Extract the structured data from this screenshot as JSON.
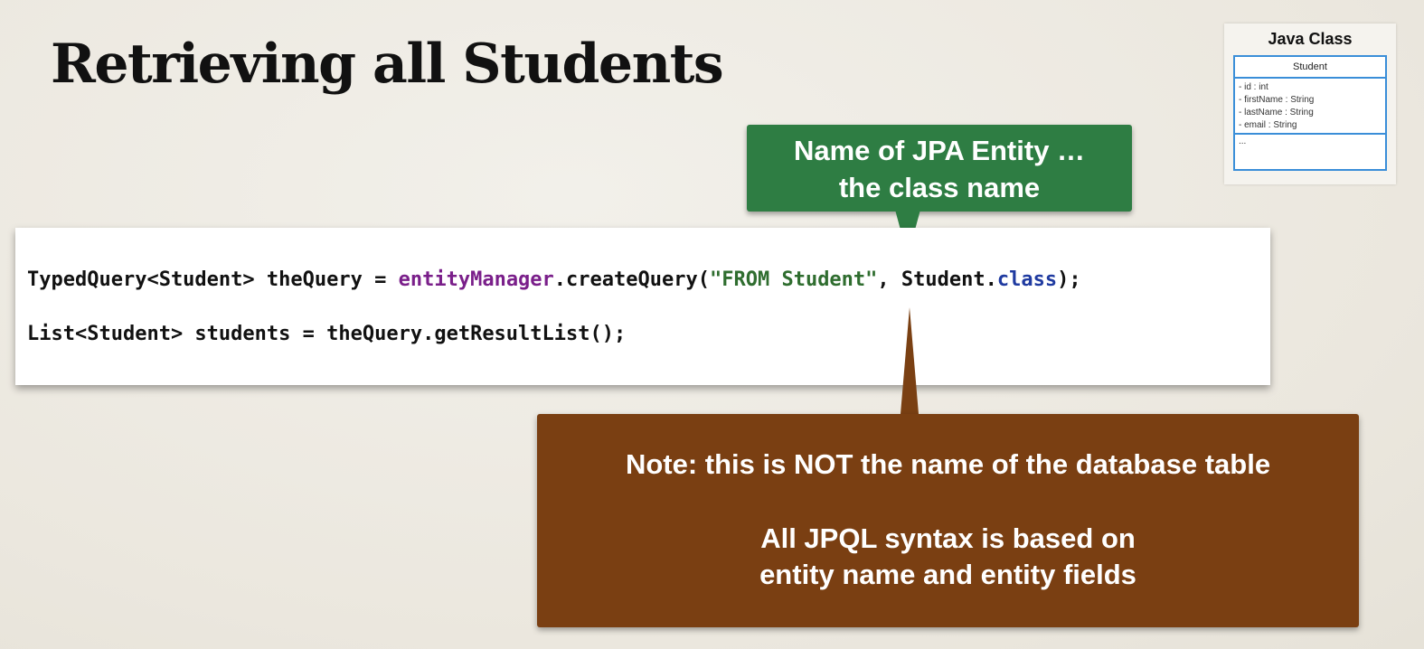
{
  "slide": {
    "title": "Retrieving all Students"
  },
  "uml": {
    "heading": "Java Class",
    "class_name": "Student",
    "fields": [
      "- id : int",
      "- firstName : String",
      "- lastName : String",
      "- email : String"
    ],
    "methods": "..."
  },
  "green_callout": {
    "line1": "Name of JPA Entity …",
    "line2": "the class name"
  },
  "code": {
    "line1": {
      "prefix": "TypedQuery<Student> theQuery = ",
      "object": "entityManager",
      "call": ".createQuery(",
      "string": "\"FROM Student\"",
      "middle": ", Student.",
      "keyword": "class",
      "suffix": ");"
    },
    "line2": "List<Student> students = theQuery.getResultList();"
  },
  "brown_callout": {
    "line1": "Note: this is NOT the name of the database table",
    "line2a": "All JPQL syntax is based on",
    "line2b": "entity name and entity fields"
  },
  "colors": {
    "green_callout": "#2e7d43",
    "brown_callout": "#7a3f12",
    "uml_border": "#3a8ed8",
    "code_object": "#7a1f8a",
    "code_string": "#2f6d2f",
    "code_keyword": "#1f3aa0"
  }
}
